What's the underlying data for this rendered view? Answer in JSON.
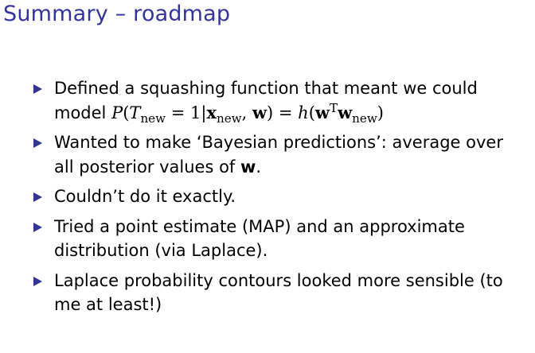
{
  "title": "Summary – roadmap",
  "bullets": [
    {
      "parts": [
        "Defined a squashing function that meant we could model "
      ]
    },
    {
      "text": "Wanted to make ‘Bayesian predictions’: average over all posterior values of "
    },
    {
      "text": "Couldn’t do it exactly."
    },
    {
      "text": "Tried a point estimate (MAP) and an approximate distribution (via Laplace)."
    },
    {
      "text": "Laplace probability contours looked more sensible (to me at least!)"
    }
  ],
  "math": {
    "P": "P",
    "T": "T",
    "new": "new",
    "eq1": " = 1|",
    "x": "x",
    "w": "w",
    "h": "h",
    "sup_T": "T",
    "bold_w": "w",
    "comma": ", ",
    "close_paren": ")",
    "open_paren": "(",
    "eq2": " = ",
    "period": "."
  },
  "accent_color": "#33339b",
  "bullet_icon": "triangle-right-icon"
}
